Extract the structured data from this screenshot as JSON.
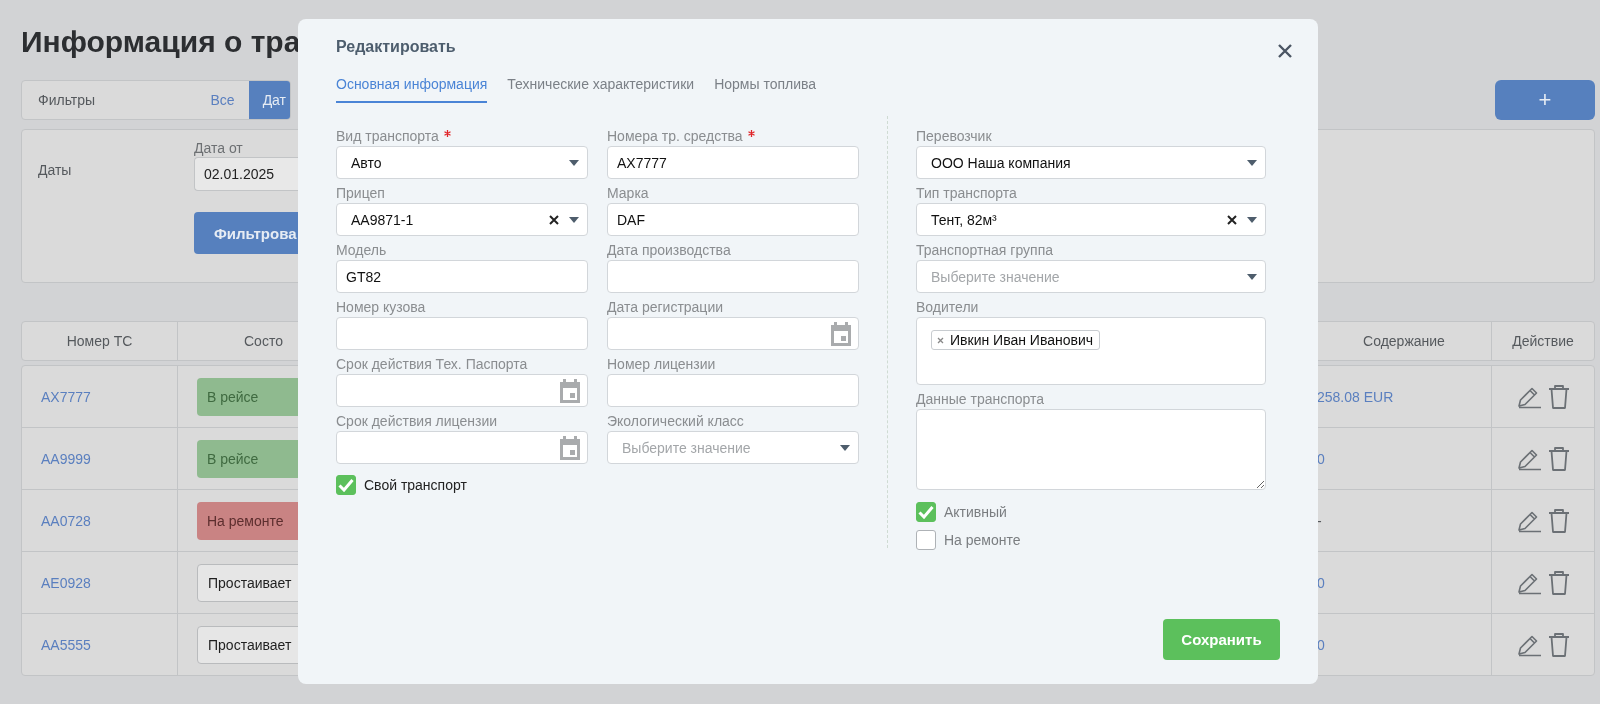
{
  "page": {
    "title": "Информация о тра",
    "filters": {
      "label": "Фильтры",
      "tabs": [
        {
          "label": "Все",
          "selected": false
        },
        {
          "label": "Дат",
          "selected": true
        }
      ],
      "add_button": "+"
    },
    "dates_panel": {
      "label": "Даты",
      "date_from": {
        "label": "Дата от",
        "value": "02.01.2025"
      },
      "filter_button": "Фильтрова"
    },
    "table": {
      "columns": [
        "Номер ТС",
        "Состо",
        "Содержание",
        "Действие"
      ],
      "rows": [
        {
          "number": "AX7777",
          "status": {
            "text": "В рейсе",
            "kind": "trip"
          },
          "content": "258.08 EUR"
        },
        {
          "number": "AA9999",
          "status": {
            "text": "В рейсе",
            "kind": "trip"
          },
          "content": "0"
        },
        {
          "number": "AA0728",
          "status": {
            "text": "На ремонте",
            "kind": "repair"
          },
          "content": "-"
        },
        {
          "number": "AE0928",
          "status": {
            "text": "Простаивает",
            "kind": "idle"
          },
          "content": "0"
        },
        {
          "number": "AA5555",
          "status": {
            "text": "Простаивает",
            "kind": "idle"
          },
          "content": "0"
        }
      ]
    }
  },
  "modal": {
    "title": "Редактировать",
    "tabs": [
      {
        "label": "Основная информация",
        "selected": true
      },
      {
        "label": "Технические характеристики",
        "selected": false
      },
      {
        "label": "Нормы топлива",
        "selected": false
      }
    ],
    "columns": [
      {
        "fields": [
          {
            "label": "Вид транспорта",
            "required": true,
            "kind": "select",
            "value": "Авто",
            "clearable": false
          },
          {
            "label": "Прицеп",
            "required": false,
            "kind": "select",
            "value": "AA9871-1",
            "clearable": true
          },
          {
            "label": "Модель",
            "required": false,
            "kind": "text",
            "value": "GT82"
          },
          {
            "label": "Номер кузова",
            "required": false,
            "kind": "text"
          },
          {
            "label": "Срок действия Тех. Паспорта",
            "required": false,
            "kind": "date"
          },
          {
            "label": "Срок действия лицензии",
            "required": false,
            "kind": "date"
          }
        ],
        "checkboxes": [
          {
            "label": "Свой транспорт",
            "checked": true
          }
        ]
      },
      {
        "fields": [
          {
            "label": "Номера тр. средства",
            "required": true,
            "kind": "text",
            "value": "AX7777"
          },
          {
            "label": "Марка",
            "required": false,
            "kind": "text",
            "value": "DAF"
          },
          {
            "label": "Дата производства",
            "required": false,
            "kind": "text"
          },
          {
            "label": "Дата регистрации",
            "required": false,
            "kind": "date"
          },
          {
            "label": "Номер лицензии",
            "required": false,
            "kind": "text"
          },
          {
            "label": "Экологический класс",
            "required": false,
            "kind": "select",
            "placeholder": "Выберите значение",
            "clearable": false
          }
        ]
      },
      {
        "fields": [
          {
            "label": "Перевозчик",
            "required": false,
            "kind": "select",
            "value": "ООО Наша компания",
            "clearable": false
          },
          {
            "label": "Тип транспорта",
            "required": false,
            "kind": "select",
            "value": "Тент, 82м³",
            "clearable": true
          },
          {
            "label": "Транспортная группа",
            "required": false,
            "kind": "select",
            "placeholder": "Выберите значение",
            "clearable": false
          },
          {
            "label": "Водители",
            "required": false,
            "kind": "tags",
            "tags": [
              "Ивкин Иван Иванович"
            ]
          },
          {
            "label": "Данные транспорта",
            "required": false,
            "kind": "textarea"
          }
        ],
        "checkboxes": [
          {
            "label": "Активный",
            "checked": true
          },
          {
            "label": "На ремонте",
            "checked": false
          }
        ]
      }
    ],
    "save_button": "Сохранить"
  }
}
